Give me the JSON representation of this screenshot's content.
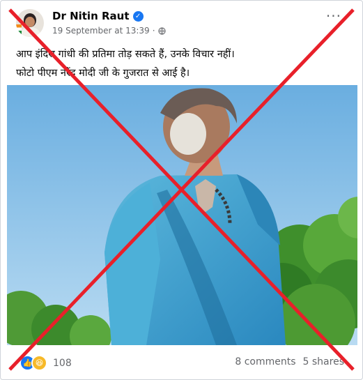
{
  "post": {
    "author": "Dr Nitin Raut",
    "timestamp": "19 September at 13:39",
    "text_line1": "आप इंदिरा गांधी की प्रतिमा तोड़ सकते हैं, उनके विचार नहीं।",
    "text_line2": "फोटो पीएम नरेंद्र मोदी जी के गुजरात से आई है।"
  },
  "footer": {
    "reaction_count": "108",
    "comments": "8 comments",
    "shares": "5 shares"
  },
  "icons": {
    "verified": "verified-badge-icon",
    "privacy": "globe-icon",
    "more": "more-options-icon",
    "like": "like-reaction-icon",
    "haha": "haha-reaction-icon"
  },
  "colors": {
    "cross": "#e8202a",
    "brand": "#1877f2",
    "sky": "#8ec1e6",
    "saree": "#3a9ecf"
  }
}
